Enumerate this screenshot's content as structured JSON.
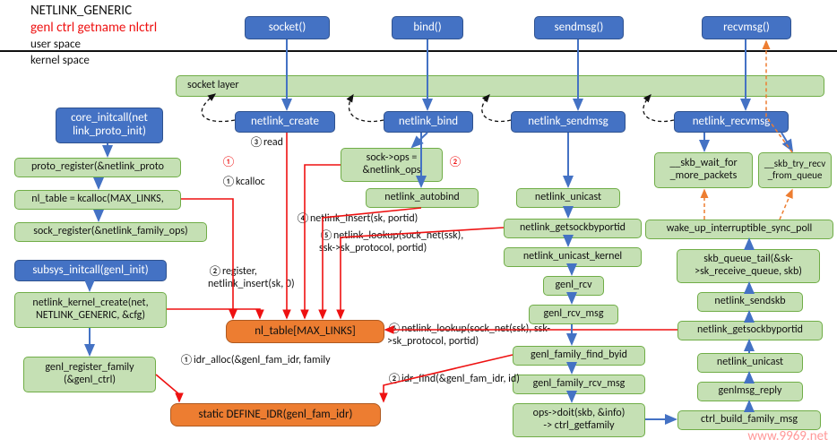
{
  "header": {
    "title": "NETLINK_GENERIC",
    "subtitle": "genl ctrl getname nlctrl",
    "user_space": "user space",
    "kernel_space": "kernel space",
    "socket_layer": "socket layer"
  },
  "top": {
    "socket": "socket()",
    "bind": "bind()",
    "sendmsg": "sendmsg()",
    "recvmsg": "recvmsg()"
  },
  "kernel_top": {
    "netlink_create": "netlink_create",
    "netlink_bind": "netlink_bind",
    "netlink_sendmsg": "netlink_sendmsg",
    "netlink_recvmsg": "netlink_recvmsg"
  },
  "init": {
    "core_initcall": "core_initcall(net\nlink_proto_init)",
    "proto_register": "proto_register(&netlink_proto",
    "nl_table_kcalloc": "nl_table = kcalloc(MAX_LINKS,",
    "sock_register": "sock_register(&netlink_family_ops)",
    "subsys_initcall": "subsys_initcall(genl_init)",
    "netlink_kernel_create": "netlink_kernel_create(net,\nNETLINK_GENERIC, &cfg)",
    "genl_register_family": "genl_register_family\n(&genl_ctrl)"
  },
  "center": {
    "nl_table": "nl_table[MAX_LINKS]",
    "define_idr": "static DEFINE_IDR(genl_fam_idr)"
  },
  "bind_col": {
    "sock_ops": "sock->ops =\n&netlink_ops",
    "netlink_autobind": "netlink_autobind"
  },
  "send_col": {
    "netlink_unicast": "netlink_unicast",
    "netlink_getsockbyportid": "netlink_getsockbyportid",
    "netlink_unicast_kernel": "netlink_unicast_kernel",
    "genl_rcv": "genl_rcv",
    "genl_rcv_msg": "genl_rcv_msg",
    "genl_family_find_byid": "genl_family_find_byid",
    "genl_family_rcv_msg": "genl_family_rcv_msg",
    "ops_doit": "ops->doit(skb, &info)\n-> ctrl_getfamily"
  },
  "recv_col": {
    "skb_wait": "__skb_wait_for\n_more_packets",
    "skb_try_recv": "__skb_try_recv\n_from_queue",
    "wake_up": "wake_up_interruptible_sync_poll",
    "skb_queue_tail": "skb_queue_tail(&sk-\n>sk_receive_queue, skb)",
    "netlink_sendskb": "netlink_sendskb",
    "netlink_getsockbyportid2": "netlink_getsockbyportid",
    "netlink_unicast2": "netlink_unicast",
    "genlmsg_reply": "genlmsg_reply",
    "ctrl_build_family_msg": "ctrl_build_family_msg"
  },
  "annot": {
    "kcalloc": "①kcalloc",
    "register": "②register,\nnetlink_insert(sk, 0)",
    "read": "③read",
    "circled1": "①",
    "circled2": "②",
    "netlink_insert": "④netlink_insert(sk, portid)",
    "netlink_lookup5": "⑤netlink_lookup(sock_net(ssk),\nssk->sk_protocol, portid)",
    "netlink_lookup6": "⑥netlink_lookup(sock_net(ssk), ssk-\n>sk_protocol, portid)",
    "idr_alloc": "①idr_alloc(&genl_fam_idr, family",
    "idr_find": "②idr_find(&genl_fam_idr, id)"
  },
  "watermark": "www.9969.net"
}
